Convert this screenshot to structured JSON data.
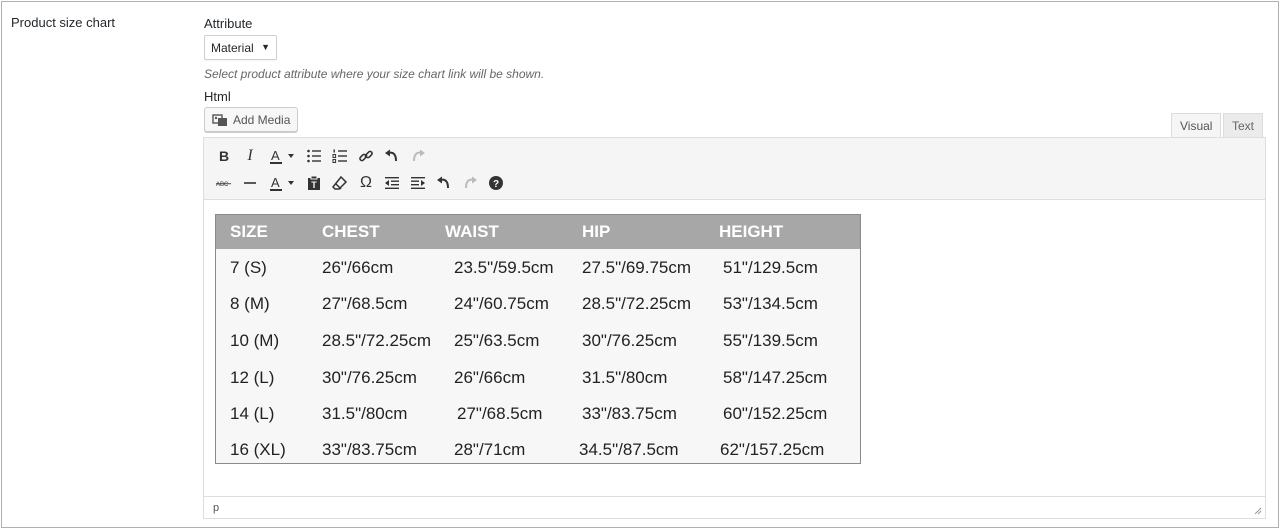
{
  "row_label": "Product size chart",
  "attribute": {
    "label": "Attribute",
    "selected": "Material",
    "help": "Select product attribute where your size chart link will be shown."
  },
  "html": {
    "label": "Html",
    "add_media": "Add Media",
    "tabs": {
      "visual": "Visual",
      "text": "Text"
    },
    "status_path": "p"
  },
  "table": {
    "headers": [
      "SIZE",
      "CHEST",
      "WAIST",
      "HIP",
      "HEIGHT"
    ],
    "rows": [
      [
        "7 (S)",
        "26\"/66cm",
        "23.5\"/59.5cm",
        "27.5\"/69.75cm",
        "51\"/129.5cm"
      ],
      [
        "8 (M)",
        "27\"/68.5cm",
        "24\"/60.75cm",
        "28.5\"/72.25cm",
        "53\"/134.5cm"
      ],
      [
        "10 (M)",
        "28.5\"/72.25cm",
        "25\"/63.5cm",
        "30\"/76.25cm",
        "55\"/139.5cm"
      ],
      [
        "12 (L)",
        "30\"/76.25cm",
        "26\"/66cm",
        "31.5\"/80cm",
        "58\"/147.25cm"
      ],
      [
        "14 (L)",
        "31.5\"/80cm",
        "27\"/68.5cm",
        "33\"/83.75cm",
        "60\"/152.25cm"
      ],
      [
        "16 (XL)",
        "33\"/83.75cm",
        "28\"/71cm",
        "34.5\"/87.5cm",
        "62\"/157.25cm"
      ]
    ]
  },
  "colors": {
    "table_header_bg": "#a7a7a7",
    "toolbar_bg": "#f5f5f5",
    "border": "#dedede"
  }
}
